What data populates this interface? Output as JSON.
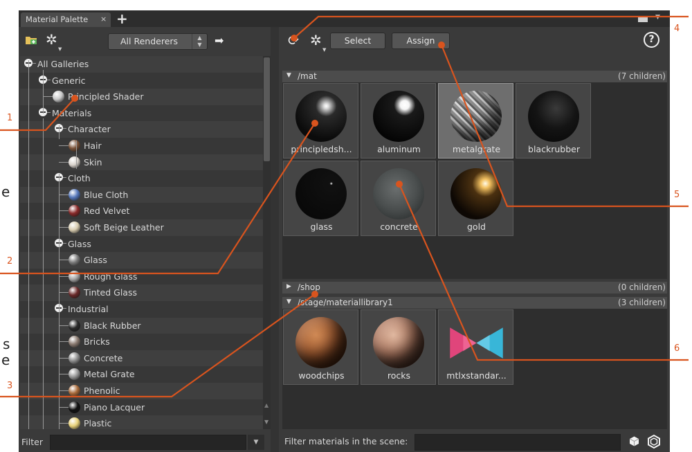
{
  "tabs": [
    {
      "label": "Material Palette",
      "close": "×"
    }
  ],
  "tab_add": "+",
  "left_toolbar": {
    "renderer_dropdown": "All Renderers",
    "spin": "▲\n▼"
  },
  "tree": [
    {
      "label": "All Galleries",
      "type": "folder",
      "level": 0
    },
    {
      "label": "Generic",
      "type": "folder",
      "level": 1
    },
    {
      "label": "Principled Shader",
      "type": "item",
      "level": 2,
      "ball": "#c9c9c9"
    },
    {
      "label": "Materials",
      "type": "folder",
      "level": 1
    },
    {
      "label": "Character",
      "type": "folder",
      "level": 2
    },
    {
      "label": "Hair",
      "type": "item",
      "level": 3,
      "ball": "#7a5238"
    },
    {
      "label": "Skin",
      "type": "item",
      "level": 3,
      "ball": "#d9d3cc"
    },
    {
      "label": "Cloth",
      "type": "folder",
      "level": 2
    },
    {
      "label": "Blue Cloth",
      "type": "item",
      "level": 3,
      "ball": "#5577bb"
    },
    {
      "label": "Red Velvet",
      "type": "item",
      "level": 3,
      "ball": "#8a2a2a"
    },
    {
      "label": "Soft Beige Leather",
      "type": "item",
      "level": 3,
      "ball": "#d8ccb0"
    },
    {
      "label": "Glass",
      "type": "folder",
      "level": 2
    },
    {
      "label": "Glass",
      "type": "item",
      "level": 3,
      "ball": "#7a7a7a"
    },
    {
      "label": "Rough Glass",
      "type": "item",
      "level": 3,
      "ball": "#a8a8a8"
    },
    {
      "label": "Tinted Glass",
      "type": "item",
      "level": 3,
      "ball": "#6a2a2a"
    },
    {
      "label": "Industrial",
      "type": "folder",
      "level": 2
    },
    {
      "label": "Black Rubber",
      "type": "item",
      "level": 3,
      "ball": "#2a2a2a"
    },
    {
      "label": "Bricks",
      "type": "item",
      "level": 3,
      "ball": "#8a7a70"
    },
    {
      "label": "Concrete",
      "type": "item",
      "level": 3,
      "ball": "#8e8e8e"
    },
    {
      "label": "Metal Grate",
      "type": "item",
      "level": 3,
      "ball": "#9a9a9a"
    },
    {
      "label": "Phenolic",
      "type": "item",
      "level": 3,
      "ball": "#a86a3a"
    },
    {
      "label": "Piano Lacquer",
      "type": "item",
      "level": 3,
      "ball": "#111111"
    },
    {
      "label": "Plastic",
      "type": "item",
      "level": 3,
      "ball": "#e8d27a"
    }
  ],
  "left_filter": {
    "label": "Filter",
    "value": ""
  },
  "right_toolbar": {
    "select": "Select",
    "assign": "Assign",
    "help": "?"
  },
  "sections": [
    {
      "path": "/mat",
      "count": "(7 children)",
      "expanded": true,
      "items": [
        {
          "name": "principledsh...",
          "kind": "black-glossy"
        },
        {
          "name": "aluminum",
          "kind": "black-shiny"
        },
        {
          "name": "metalgrate",
          "kind": "metalgrate",
          "selected": true
        },
        {
          "name": "blackrubber",
          "kind": "black-matte"
        },
        {
          "name": "glass",
          "kind": "glass"
        },
        {
          "name": "concrete",
          "kind": "concrete"
        },
        {
          "name": "gold",
          "kind": "gold"
        }
      ]
    },
    {
      "path": "/shop",
      "count": "(0 children)",
      "expanded": false,
      "items": []
    },
    {
      "path": "/stage/materiallibrary1",
      "count": "(3 children)",
      "expanded": true,
      "items": [
        {
          "name": "woodchips",
          "kind": "woodchips"
        },
        {
          "name": "rocks",
          "kind": "rocks"
        },
        {
          "name": "mtlxstandar...",
          "kind": "mtlx"
        }
      ]
    }
  ],
  "right_filter": {
    "label": "Filter materials in the scene:",
    "value": ""
  },
  "callouts": [
    {
      "num": "1"
    },
    {
      "num": "2"
    },
    {
      "num": "3"
    },
    {
      "num": "4"
    },
    {
      "num": "5"
    },
    {
      "num": "6"
    }
  ],
  "page_edge_text": [
    "e",
    "s",
    "e"
  ],
  "colors": {
    "accent": "#d9541e",
    "panel": "#3a3a3a",
    "tile_selected": "#6e6e6e"
  }
}
